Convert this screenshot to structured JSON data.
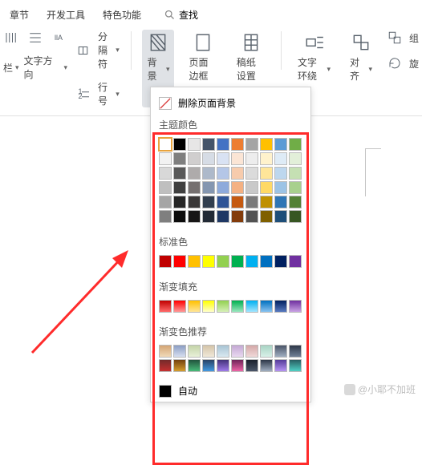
{
  "tabs": {
    "chapters": "章节",
    "devtools": "开发工具",
    "special": "特色功能",
    "search": "查找"
  },
  "ribbon": {
    "col_label": "栏",
    "text_dir": "文字方向",
    "separator": "分隔符",
    "line_no": "行号",
    "background": "背景",
    "page_border": "页面边框",
    "paper": "稿纸设置",
    "wrap": "文字环绕",
    "align": "对齐",
    "rotate": "旋",
    "group": "组"
  },
  "dd": {
    "remove": "删除页面背景",
    "theme": "主题颜色",
    "standard": "标准色",
    "gradient": "渐变填充",
    "gradient_rec": "渐变色推荐",
    "auto": "自动"
  },
  "wm": "@小耶不加班",
  "theme_rows": [
    [
      "#ffffff",
      "#000000",
      "#e7e6e6",
      "#44546a",
      "#4472c4",
      "#ed7d31",
      "#a5a5a5",
      "#ffc000",
      "#5b9bd5",
      "#70ad47"
    ],
    [
      "#f2f2f2",
      "#7f7f7f",
      "#d0cece",
      "#d6dce5",
      "#d9e2f3",
      "#fbe5d5",
      "#ededed",
      "#fff2cc",
      "#deebf6",
      "#e2efd9"
    ],
    [
      "#d8d8d8",
      "#595959",
      "#aeabab",
      "#adb9ca",
      "#b4c6e7",
      "#f7cbac",
      "#dbdbdb",
      "#fee599",
      "#bdd7ee",
      "#c5e0b3"
    ],
    [
      "#bfbfbf",
      "#3f3f3f",
      "#757070",
      "#8496b0",
      "#8eaadb",
      "#f4b183",
      "#c9c9c9",
      "#ffd965",
      "#9cc3e5",
      "#a8d08d"
    ],
    [
      "#a5a5a5",
      "#262626",
      "#3a3838",
      "#323f4f",
      "#2f5496",
      "#c55a11",
      "#7b7b7b",
      "#bf9000",
      "#2e75b5",
      "#538135"
    ],
    [
      "#7f7f7f",
      "#0c0c0c",
      "#171616",
      "#222a35",
      "#1f3864",
      "#833c0b",
      "#525252",
      "#7f6000",
      "#1e4e79",
      "#375623"
    ]
  ],
  "standard_row": [
    "#c00000",
    "#ff0000",
    "#ffc000",
    "#ffff00",
    "#92d050",
    "#00b050",
    "#00b0f0",
    "#0070c0",
    "#002060",
    "#7030a0"
  ],
  "grad_row": [
    [
      "#c00000",
      "#ff6b6b"
    ],
    [
      "#ff0000",
      "#ff9999"
    ],
    [
      "#ffc000",
      "#ffe699"
    ],
    [
      "#ffff00",
      "#ffffcc"
    ],
    [
      "#92d050",
      "#d6f0b8"
    ],
    [
      "#00b050",
      "#9be7bf"
    ],
    [
      "#00b0f0",
      "#a3e6ff"
    ],
    [
      "#0070c0",
      "#8ac3f0"
    ],
    [
      "#002060",
      "#5a7bc0"
    ],
    [
      "#7030a0",
      "#c9a3e3"
    ]
  ],
  "grad_rec": [
    [
      [
        "#d4a574",
        "#f0d9b8"
      ],
      [
        "#8b9dc3",
        "#d6def0"
      ],
      [
        "#c4d4a8",
        "#e8f0d8"
      ],
      [
        "#d4c4a8",
        "#f0e8d8"
      ],
      [
        "#a8c4d4",
        "#d8e8f0"
      ],
      [
        "#c4a8d4",
        "#e8d8f0"
      ],
      [
        "#d4a8a8",
        "#f0d8d8"
      ],
      [
        "#a8d4c4",
        "#d8f0e8"
      ],
      [
        "#4a5568",
        "#a0aec0"
      ],
      [
        "#2d3748",
        "#718096"
      ]
    ],
    [
      [
        "#742a2a",
        "#c53030"
      ],
      [
        "#744210",
        "#d69e2e"
      ],
      [
        "#22543d",
        "#48bb78"
      ],
      [
        "#2a4365",
        "#4299e1"
      ],
      [
        "#44337a",
        "#9f7aea"
      ],
      [
        "#702459",
        "#ed64a6"
      ],
      [
        "#1a202c",
        "#4a5568"
      ],
      [
        "#2d3748",
        "#a0aec0"
      ],
      [
        "#553c9a",
        "#b794f4"
      ],
      [
        "#285e61",
        "#4fd1c5"
      ]
    ]
  ]
}
